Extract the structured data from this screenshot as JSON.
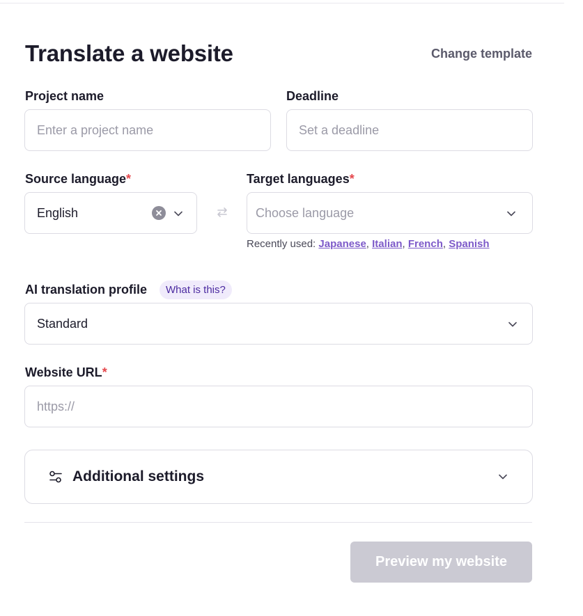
{
  "header": {
    "title": "Translate a website",
    "change_template": "Change template"
  },
  "project_name": {
    "label": "Project name",
    "placeholder": "Enter a project name"
  },
  "deadline": {
    "label": "Deadline",
    "placeholder": "Set a deadline"
  },
  "source_language": {
    "label": "Source language",
    "required_mark": "*",
    "value": "English"
  },
  "target_languages": {
    "label": "Target languages",
    "required_mark": "*",
    "placeholder": "Choose language",
    "recently_used_label": "Recently used:",
    "recent": [
      "Japanese",
      "Italian",
      "French",
      "Spanish"
    ]
  },
  "ai_profile": {
    "label": "AI translation profile",
    "help_badge": "What is this?",
    "value": "Standard"
  },
  "website_url": {
    "label": "Website URL",
    "required_mark": "*",
    "placeholder": "https://"
  },
  "additional_settings": {
    "label": "Additional settings"
  },
  "actions": {
    "preview_label": "Preview my website"
  },
  "colors": {
    "text": "#1c1b2a",
    "link_purple": "#7d5ac9",
    "required_red": "#e5484d",
    "disabled_button": "#cbcad3"
  },
  "icons": {
    "clear": "clear-circle-icon",
    "swap": "swap-arrows-icon",
    "chevron": "chevron-down-icon",
    "settings": "sliders-icon"
  }
}
